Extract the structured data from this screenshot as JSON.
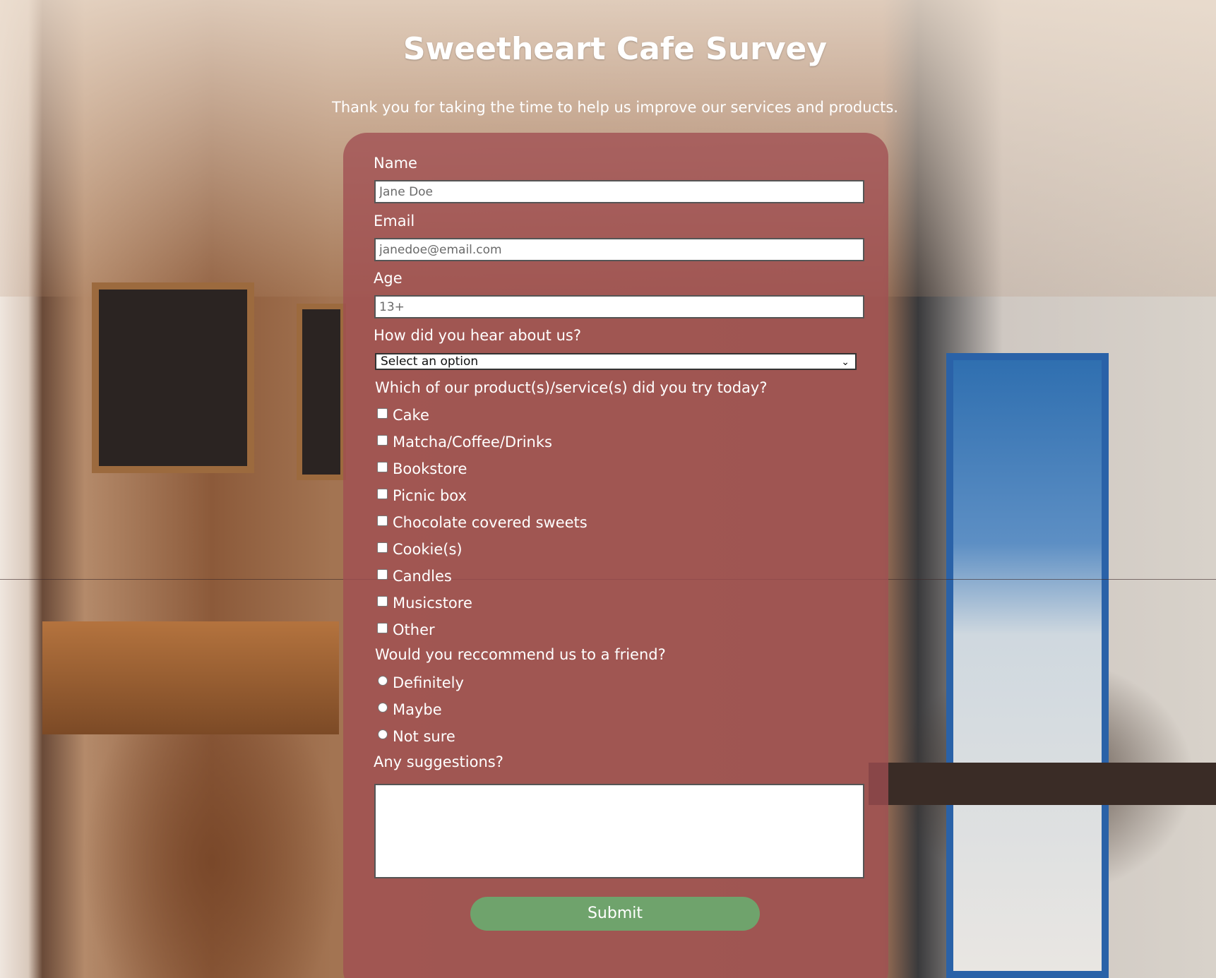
{
  "page": {
    "title": "Sweetheart Cafe Survey",
    "subtitle": "Thank you for taking the time to help us improve our services and products."
  },
  "form": {
    "name": {
      "label": "Name",
      "placeholder": "Jane Doe",
      "value": ""
    },
    "email": {
      "label": "Email",
      "placeholder": "janedoe@email.com",
      "value": ""
    },
    "age": {
      "label": "Age",
      "placeholder": "13+",
      "value": ""
    },
    "referral": {
      "label": "How did you hear about us?",
      "selected": "Select an option"
    },
    "products": {
      "label": "Which of our product(s)/service(s) did you try today?",
      "options": [
        "Cake",
        "Matcha/Coffee/Drinks",
        "Bookstore",
        "Picnic box",
        "Chocolate covered sweets",
        "Cookie(s)",
        "Candles",
        "Musicstore",
        "Other"
      ]
    },
    "recommend": {
      "label": "Would you reccommend us to a friend?",
      "options": [
        "Definitely",
        "Maybe",
        "Not sure"
      ]
    },
    "suggestions": {
      "label": "Any suggestions?",
      "value": ""
    },
    "submit_label": "Submit"
  },
  "colors": {
    "card": "#a04e52",
    "submit": "#6fa36c",
    "text": "#ffffff"
  },
  "icons": [
    "chevron-down-icon"
  ]
}
